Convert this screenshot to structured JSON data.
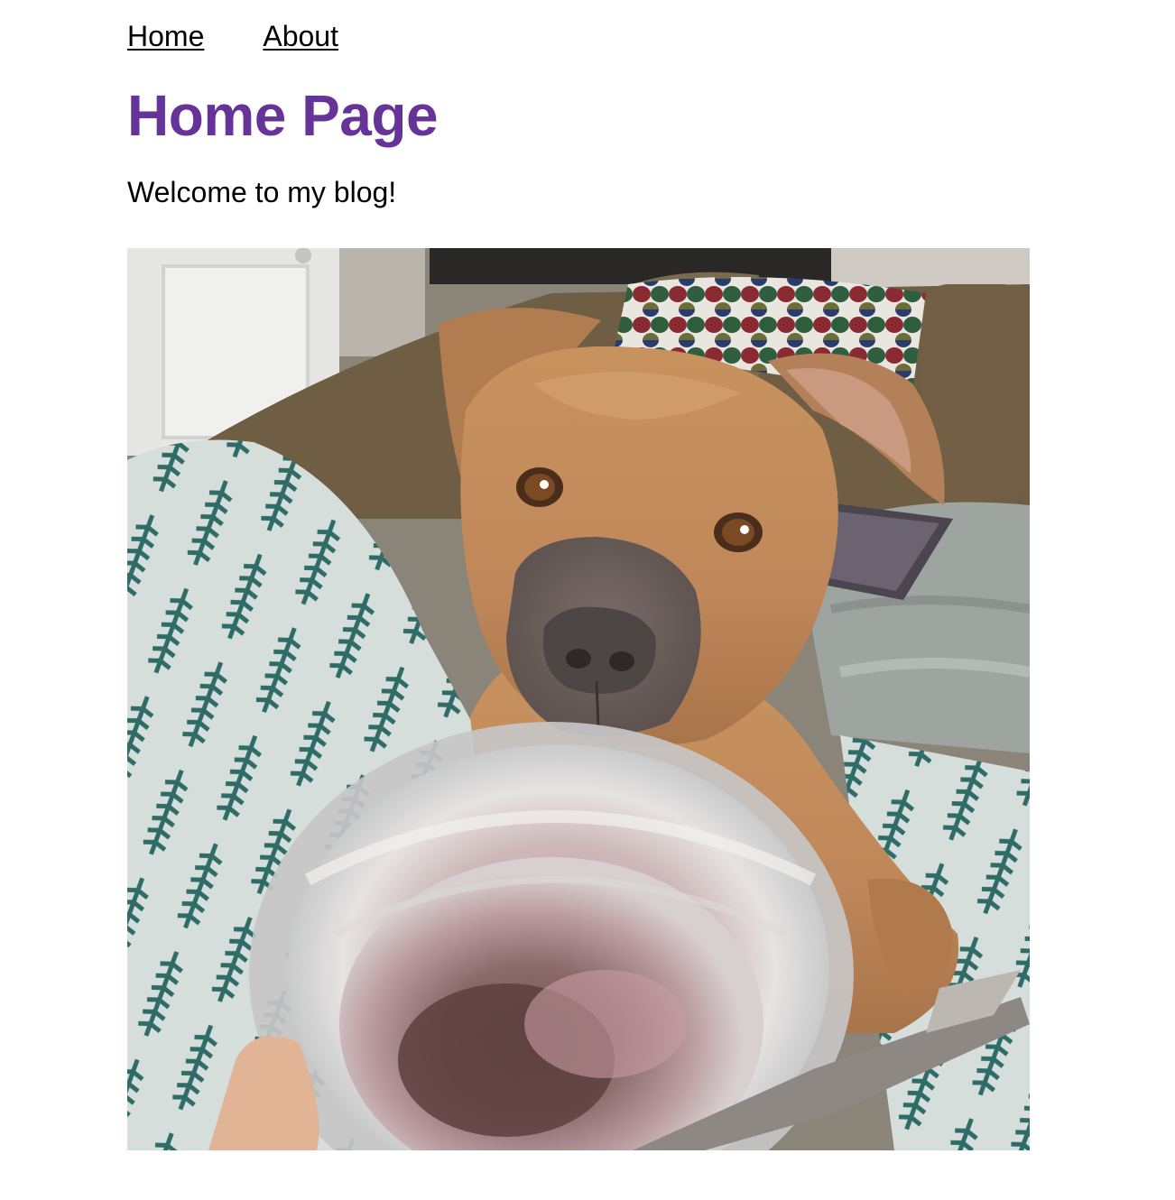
{
  "nav": {
    "items": [
      {
        "label": "Home"
      },
      {
        "label": "About"
      }
    ]
  },
  "page": {
    "title": "Home Page",
    "intro": "Welcome to my blog!"
  },
  "colors": {
    "title": "#663399",
    "link": "#000000",
    "text": "#000000",
    "background": "#ffffff"
  },
  "photo": {
    "subject": "dog-photo"
  }
}
